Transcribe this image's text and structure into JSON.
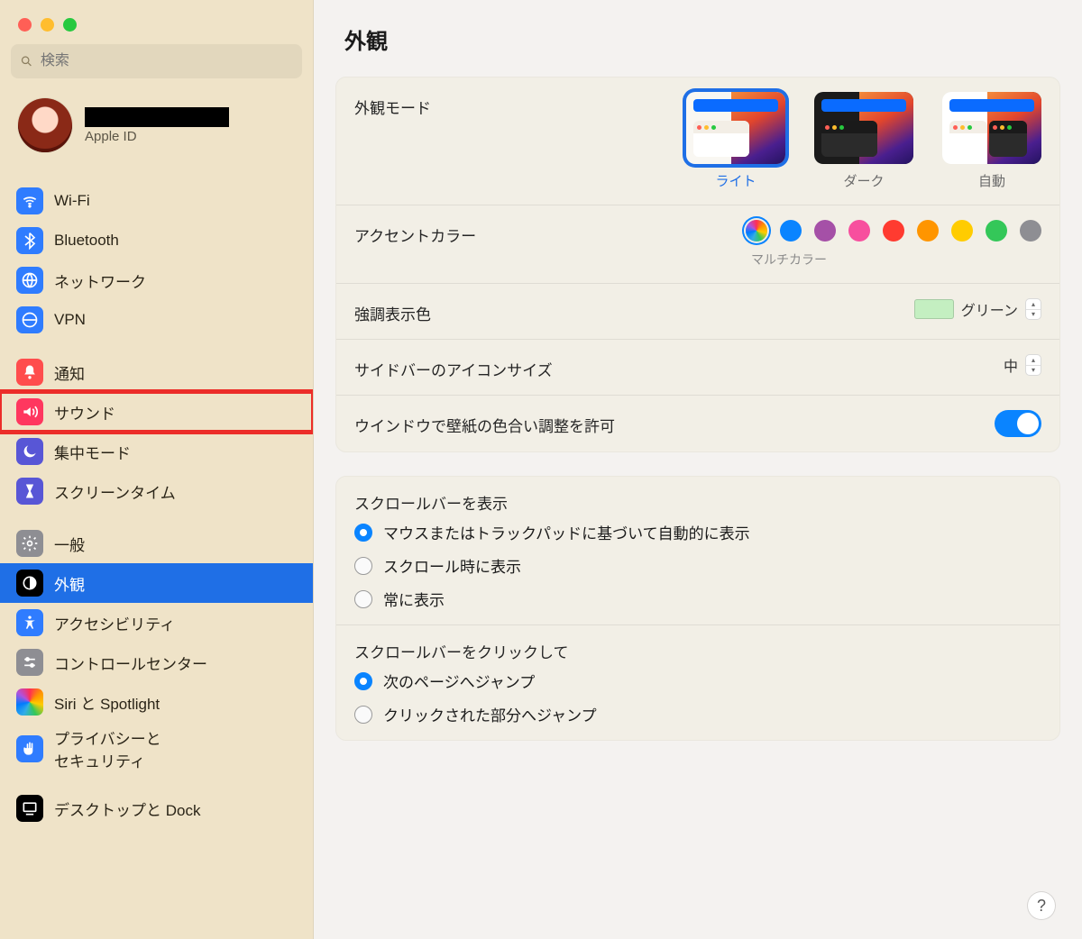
{
  "search": {
    "placeholder": "検索"
  },
  "account": {
    "sub": "Apple ID"
  },
  "sidebar": {
    "groups": [
      {
        "items": [
          {
            "k": "wifi",
            "label": "Wi-Fi"
          },
          {
            "k": "bluetooth",
            "label": "Bluetooth"
          },
          {
            "k": "network",
            "label": "ネットワーク"
          },
          {
            "k": "vpn",
            "label": "VPN"
          }
        ]
      },
      {
        "items": [
          {
            "k": "notifications",
            "label": "通知"
          },
          {
            "k": "sound",
            "label": "サウンド"
          },
          {
            "k": "focus",
            "label": "集中モード"
          },
          {
            "k": "screentime",
            "label": "スクリーンタイム"
          }
        ]
      },
      {
        "items": [
          {
            "k": "general",
            "label": "一般"
          },
          {
            "k": "appearance",
            "label": "外観"
          },
          {
            "k": "accessibility",
            "label": "アクセシビリティ"
          },
          {
            "k": "controlcenter",
            "label": "コントロールセンター"
          },
          {
            "k": "spotlight",
            "label": "Siri と Spotlight"
          },
          {
            "k": "privacy",
            "label": "プライバシーと\nセキュリティ"
          }
        ]
      },
      {
        "items": [
          {
            "k": "desktop",
            "label": "デスクトップと Dock"
          }
        ]
      }
    ]
  },
  "main": {
    "title": "外観",
    "appearanceMode": {
      "label": "外観モード",
      "options": {
        "light": "ライト",
        "dark": "ダーク",
        "auto": "自動"
      }
    },
    "accent": {
      "label": "アクセントカラー",
      "sub": "マルチカラー",
      "colors": [
        "#gradient",
        "#0a84ff",
        "#a550a7",
        "#f74f9e",
        "#ff3b30",
        "#ff9500",
        "#ffcc00",
        "#34c759",
        "#8e8e93"
      ]
    },
    "highlight": {
      "label": "強調表示色",
      "value": "グリーン"
    },
    "sidebarIcon": {
      "label": "サイドバーのアイコンサイズ",
      "value": "中"
    },
    "tint": {
      "label": "ウインドウで壁紙の色合い調整を許可"
    },
    "scrollShow": {
      "label": "スクロールバーを表示",
      "opts": [
        "マウスまたはトラックパッドに基づいて自動的に表示",
        "スクロール時に表示",
        "常に表示"
      ]
    },
    "scrollClick": {
      "label": "スクロールバーをクリックして",
      "opts": [
        "次のページへジャンプ",
        "クリックされた部分へジャンプ"
      ]
    }
  }
}
